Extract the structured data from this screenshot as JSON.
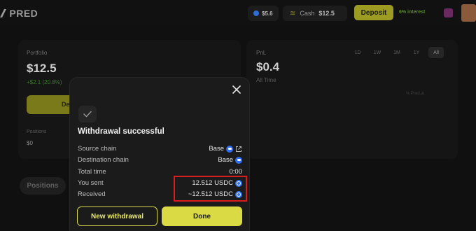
{
  "topbar": {
    "logo": "PRED",
    "balance": "$5.6",
    "cash_label": "Cash",
    "cash_value": "$12.5",
    "deposit_label": "Deposit",
    "interest": "6% interest"
  },
  "portfolio": {
    "label": "Portfolio",
    "value": "$12.5",
    "change": "+$2.1 (20.8%)",
    "deposit_label": "De",
    "positions_label": "Positions",
    "positions_value": "$0"
  },
  "pnl": {
    "label": "PnL",
    "value": "$0.4",
    "sub": "All Time",
    "ranges": [
      "1D",
      "1W",
      "1M",
      "1Y",
      "All"
    ],
    "active_range": "All",
    "faint_text": "% Pred.ai"
  },
  "tabs": {
    "positions": "Positions"
  },
  "modal": {
    "title": "Withdrawal successful",
    "rows": [
      {
        "key": "Source chain",
        "value": "Base"
      },
      {
        "key": "Destination chain",
        "value": "Base"
      },
      {
        "key": "Total time",
        "value": "0:00"
      },
      {
        "key": "You sent",
        "value": "12.512 USDC"
      },
      {
        "key": "Received",
        "value": "~12.512 USDC"
      }
    ],
    "new_withdrawal_label": "New withdrawal",
    "done_label": "Done"
  },
  "colors": {
    "accent": "#dada45",
    "highlight": "#d81e1e",
    "base_blue": "#2f6cf0"
  }
}
